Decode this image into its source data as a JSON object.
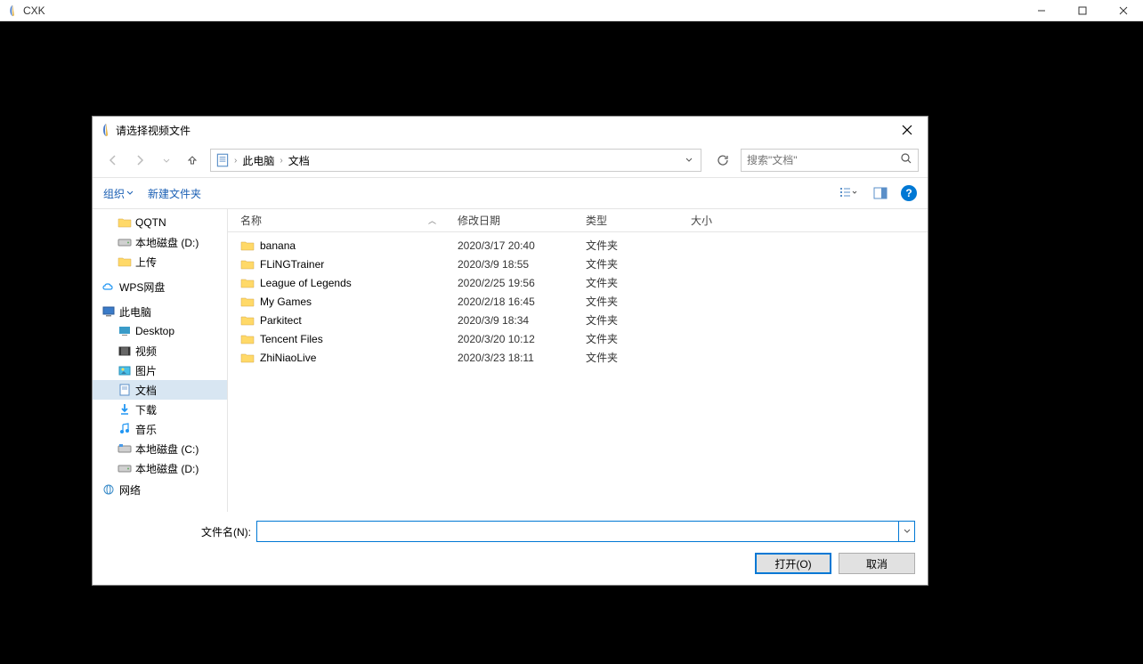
{
  "app": {
    "title": "CXK"
  },
  "dialog": {
    "title": "请选择视频文件",
    "breadcrumb": [
      "此电脑",
      "文档"
    ],
    "search_placeholder": "搜索\"文档\"",
    "toolbar": {
      "organize": "组织",
      "new_folder": "新建文件夹"
    },
    "sidebar": {
      "items": [
        {
          "label": "QQTN",
          "icon": "folder",
          "indent": 1
        },
        {
          "label": "本地磁盘 (D:)",
          "icon": "disk",
          "indent": 1
        },
        {
          "label": "上传",
          "icon": "folder",
          "indent": 1
        }
      ],
      "wps": {
        "label": "WPS网盘"
      },
      "pc": {
        "label": "此电脑",
        "children": [
          {
            "label": "Desktop",
            "icon": "desktop"
          },
          {
            "label": "视频",
            "icon": "video"
          },
          {
            "label": "图片",
            "icon": "picture"
          },
          {
            "label": "文档",
            "icon": "document",
            "selected": true
          },
          {
            "label": "下载",
            "icon": "download"
          },
          {
            "label": "音乐",
            "icon": "music"
          },
          {
            "label": "本地磁盘 (C:)",
            "icon": "disk"
          },
          {
            "label": "本地磁盘 (D:)",
            "icon": "disk"
          }
        ]
      },
      "network": {
        "label": "网络"
      }
    },
    "columns": {
      "name": "名称",
      "date": "修改日期",
      "type": "类型",
      "size": "大小"
    },
    "files": [
      {
        "name": "banana",
        "date": "2020/3/17 20:40",
        "type": "文件夹"
      },
      {
        "name": "FLiNGTrainer",
        "date": "2020/3/9 18:55",
        "type": "文件夹"
      },
      {
        "name": "League of Legends",
        "date": "2020/2/25 19:56",
        "type": "文件夹"
      },
      {
        "name": "My Games",
        "date": "2020/2/18 16:45",
        "type": "文件夹"
      },
      {
        "name": "Parkitect",
        "date": "2020/3/9 18:34",
        "type": "文件夹"
      },
      {
        "name": "Tencent Files",
        "date": "2020/3/20 10:12",
        "type": "文件夹"
      },
      {
        "name": "ZhiNiaoLive",
        "date": "2020/3/23 18:11",
        "type": "文件夹"
      }
    ],
    "filename_label": "文件名(N):",
    "filename_value": "",
    "buttons": {
      "open": "打开(O)",
      "cancel": "取消"
    }
  }
}
